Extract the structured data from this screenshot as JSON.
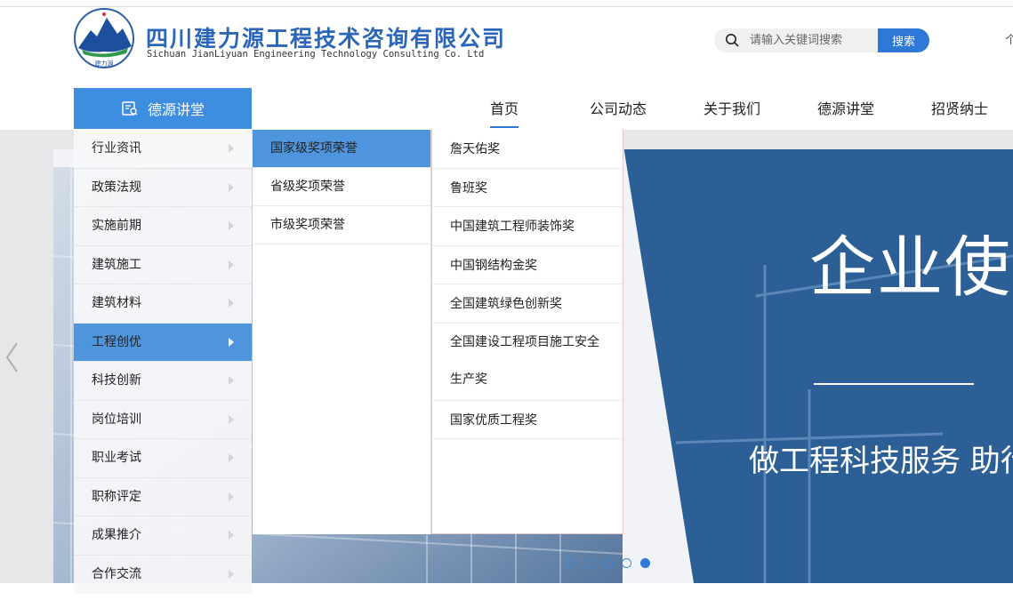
{
  "header": {
    "company_cn": "四川建力源工程技术咨询有限公司",
    "company_en": "Sichuan JianLiyuan Engineering Technology Consulting Co. Ltd",
    "logo_caption": "建力源",
    "edge_char": "个"
  },
  "search": {
    "placeholder": "请输入关键词搜索",
    "button_label": "搜索"
  },
  "category_head": {
    "label": "德源讲堂",
    "icon": "lecture-icon"
  },
  "nav": {
    "items": [
      {
        "label": "首页"
      },
      {
        "label": "公司动态"
      },
      {
        "label": "关于我们"
      },
      {
        "label": "德源讲堂"
      },
      {
        "label": "招贤纳士"
      }
    ],
    "active_index": 0
  },
  "categories": [
    {
      "label": "行业资讯"
    },
    {
      "label": "政策法规"
    },
    {
      "label": "实施前期"
    },
    {
      "label": "建筑施工"
    },
    {
      "label": "建筑材料"
    },
    {
      "label": "工程创优"
    },
    {
      "label": "科技创新"
    },
    {
      "label": "岗位培训"
    },
    {
      "label": "职业考试"
    },
    {
      "label": "职称评定"
    },
    {
      "label": "成果推介"
    },
    {
      "label": "合作交流"
    }
  ],
  "submenu_level2": [
    {
      "label": "国家级奖项荣誉"
    },
    {
      "label": "省级奖项荣誉"
    },
    {
      "label": "市级奖项荣誉"
    }
  ],
  "submenu_level3": [
    {
      "label": "詹天佑奖"
    },
    {
      "label": "鲁班奖"
    },
    {
      "label": "中国建筑工程师装饰奖"
    },
    {
      "label": "中国钢结构金奖"
    },
    {
      "label": "全国建筑绿色创新奖"
    },
    {
      "label": "全国建设工程项目施工安全生产奖"
    },
    {
      "label": "国家优质工程奖"
    }
  ],
  "banner": {
    "title": "企业使命",
    "subtitle": "做工程科技服务 助行业绿色发",
    "slide_count": 5,
    "active_slide": 5
  },
  "colors": {
    "brand_blue": "#2f78d8",
    "menu_active": "#4f95de",
    "banner_blue": "#2c5f95"
  }
}
